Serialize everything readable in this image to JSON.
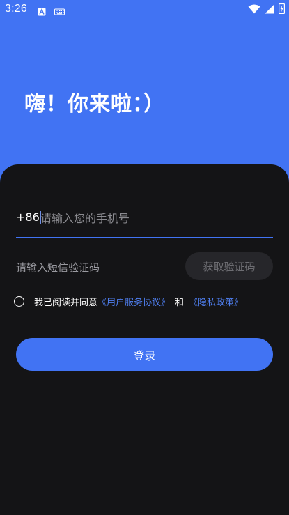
{
  "status_bar": {
    "time": "3:26",
    "left_icons": [
      "font-a-icon",
      "keyboard-icon"
    ],
    "right_icons": [
      "wifi-icon",
      "cellular-signal-icon",
      "battery-charging-icon"
    ]
  },
  "greeting": "嗨！你来啦：）",
  "login_form": {
    "country_code": "+86",
    "phone_placeholder": "请输入您的手机号",
    "phone_value": "",
    "code_placeholder": "请输入短信验证码",
    "code_value": "",
    "get_code_label": "获取验证码",
    "agreement": {
      "prefix": "我已阅读并同意",
      "user_agreement_link": "《用户服务协议》",
      "separator": "和",
      "privacy_policy_link": "《隐私政策》",
      "checked": false
    },
    "login_label": "登录"
  },
  "colors": {
    "accent": "#4173f3",
    "card_background": "#141416",
    "link": "#4f7ff0",
    "disabled_button": "#26262a"
  }
}
